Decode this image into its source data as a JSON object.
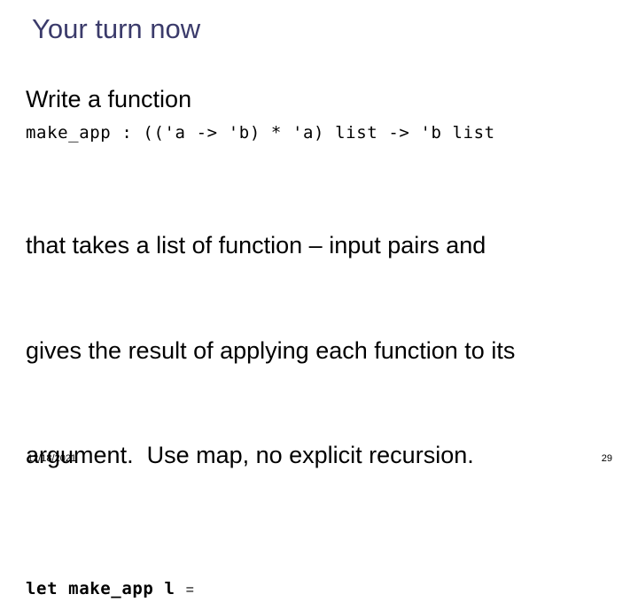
{
  "slide": {
    "title": "Your turn now",
    "title_color": "#3b3b6b",
    "background_color": "#ffffff",
    "body_color": "#000000",
    "lead_line": "Write a function",
    "type_signature": "make_app : (('a -> 'b) * 'a) list -> 'b list",
    "paragraph_lines": [
      "that takes a list of function – input pairs and",
      "gives the result of applying each function to its",
      "argument.  Use map, no explicit recursion."
    ],
    "code_stub": "let make_app l ",
    "code_stub_equals": "=",
    "footer": {
      "date": "12/18/2021",
      "page_number": "29"
    }
  }
}
